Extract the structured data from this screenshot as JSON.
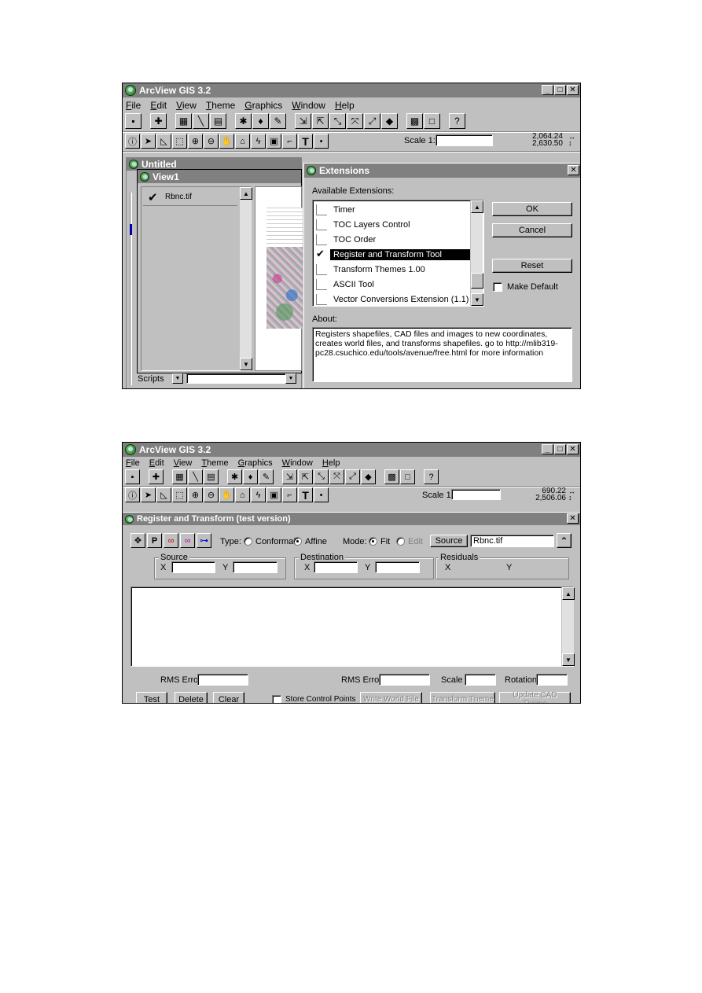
{
  "footer_link": "",
  "screenshot1": {
    "app_title": "ArcView GIS 3.2",
    "menu": [
      "File",
      "Edit",
      "View",
      "Theme",
      "Graphics",
      "Window",
      "Help"
    ],
    "scale_label": "Scale 1:",
    "scale_value": "",
    "coords": {
      "x": "2,064.24",
      "y": "2,630.50"
    },
    "project_window": {
      "title": "Untitled",
      "scripts_label": "Scripts"
    },
    "view_window": {
      "title": "View1",
      "theme_name": "Rbnc.tif"
    },
    "extensions_dialog": {
      "title": "Extensions",
      "available_label": "Available Extensions:",
      "items": [
        {
          "label": "Timer",
          "checked": false
        },
        {
          "label": "TOC Layers Control",
          "checked": false
        },
        {
          "label": "TOC Order",
          "checked": false
        },
        {
          "label": "Register and Transform Tool",
          "checked": true
        },
        {
          "label": "Transform Themes 1.00",
          "checked": false
        },
        {
          "label": "ASCII Tool",
          "checked": false
        },
        {
          "label": "Vector Conversions Extension (1.1)",
          "checked": false
        }
      ],
      "ok_label": "OK",
      "cancel_label": "Cancel",
      "reset_label": "Reset",
      "make_default_label": "Make Default",
      "about_label": "About:",
      "about_text": "Registers shapefiles, CAD files and images to new coordinates, creates world files, and transforms shapefiles. go to http://mlib319-pc28.csuchico.edu/tools/avenue/free.html for more information"
    }
  },
  "screenshot2": {
    "app_title": "ArcView GIS 3.2",
    "menu": [
      "File",
      "Edit",
      "View",
      "Theme",
      "Graphics",
      "Window",
      "Help"
    ],
    "scale_label": "Scale 1:",
    "scale_value": "",
    "coords": {
      "x": "690.22",
      "y": "2,506.06"
    },
    "dialog": {
      "title": "Register and Transform (test version)",
      "tool_buttons": [
        "P"
      ],
      "type_label": "Type:",
      "type_options": [
        "Conformal",
        "Affine"
      ],
      "type_selected": "Affine",
      "mode_label": "Mode:",
      "mode_options": [
        "Fit",
        "Edit"
      ],
      "mode_selected": "Fit",
      "source_button": "Source",
      "source_value": "Rbnc.tif",
      "source_group": "Source",
      "destination_group": "Destination",
      "residuals_group": "Residuals",
      "x_label": "X",
      "y_label": "Y",
      "rms_error_label": "RMS Error",
      "scale_label": "Scale",
      "rotation_label": "Rotation",
      "test_button": "Test",
      "delete_button": "Delete",
      "clear_button": "Clear",
      "store_control_points_label": "Store Control Points",
      "write_world_file_button": "Write World File",
      "transform_theme_button": "Transform Theme",
      "update_cad_theme_button": "Update CAD Theme"
    }
  }
}
